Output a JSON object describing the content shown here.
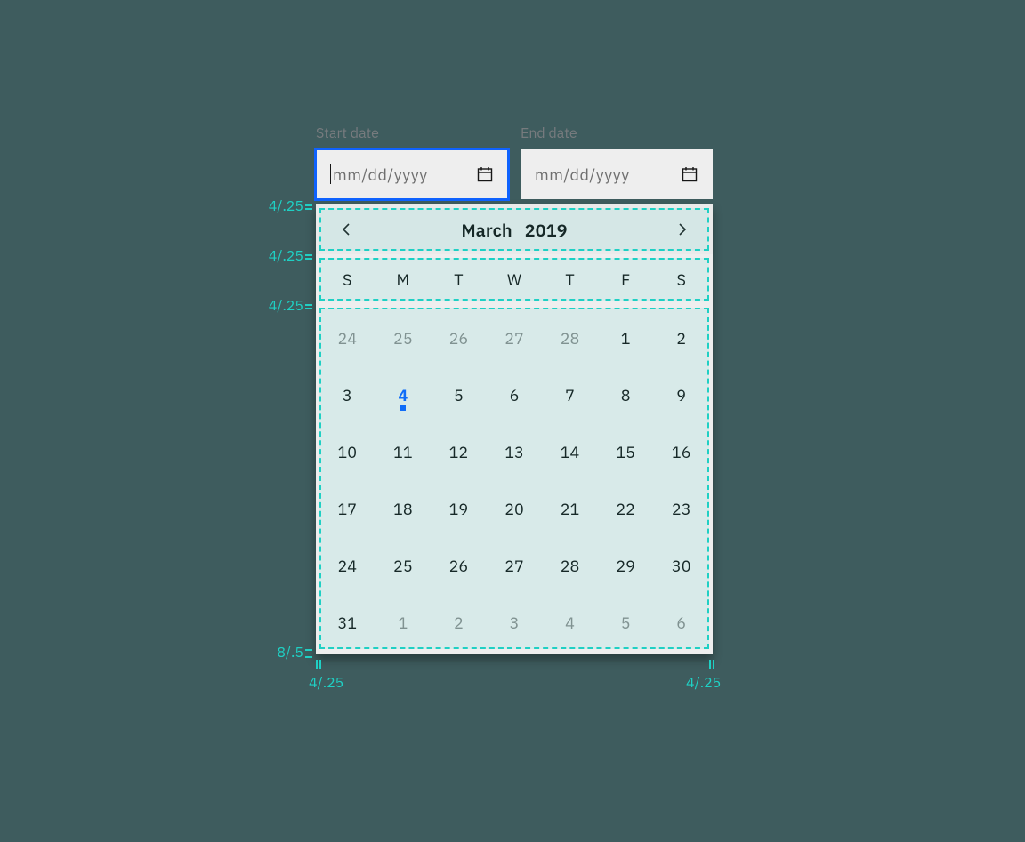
{
  "labels": {
    "start": "Start date",
    "end": "End date"
  },
  "inputs": {
    "start_placeholder": "mm/dd/yyyy",
    "end_placeholder": "mm/dd/yyyy"
  },
  "calendar": {
    "month": "March",
    "year": "2019",
    "weekdays": [
      "S",
      "M",
      "T",
      "W",
      "T",
      "F",
      "S"
    ],
    "days": [
      {
        "n": "24",
        "other": true
      },
      {
        "n": "25",
        "other": true
      },
      {
        "n": "26",
        "other": true
      },
      {
        "n": "27",
        "other": true
      },
      {
        "n": "28",
        "other": true
      },
      {
        "n": "1"
      },
      {
        "n": "2"
      },
      {
        "n": "3"
      },
      {
        "n": "4",
        "today": true
      },
      {
        "n": "5"
      },
      {
        "n": "6"
      },
      {
        "n": "7"
      },
      {
        "n": "8"
      },
      {
        "n": "9"
      },
      {
        "n": "10"
      },
      {
        "n": "11"
      },
      {
        "n": "12"
      },
      {
        "n": "13"
      },
      {
        "n": "14"
      },
      {
        "n": "15"
      },
      {
        "n": "16"
      },
      {
        "n": "17"
      },
      {
        "n": "18"
      },
      {
        "n": "19"
      },
      {
        "n": "20"
      },
      {
        "n": "21"
      },
      {
        "n": "22"
      },
      {
        "n": "23"
      },
      {
        "n": "24"
      },
      {
        "n": "25"
      },
      {
        "n": "26"
      },
      {
        "n": "27"
      },
      {
        "n": "28"
      },
      {
        "n": "29"
      },
      {
        "n": "30"
      },
      {
        "n": "31"
      },
      {
        "n": "1",
        "other": true
      },
      {
        "n": "2",
        "other": true
      },
      {
        "n": "3",
        "other": true
      },
      {
        "n": "4",
        "other": true
      },
      {
        "n": "5",
        "other": true
      },
      {
        "n": "6",
        "other": true
      }
    ]
  },
  "spec": {
    "vpad_header": "4/.25",
    "vpad_weekdays": "4/.25",
    "vpad_days": "4/.25",
    "vpad_bottom": "8/.5",
    "hpad_left": "4/.25",
    "hpad_right": "4/.25"
  },
  "colors": {
    "accent": "#0f62fe",
    "guide": "#1fd0c4"
  }
}
